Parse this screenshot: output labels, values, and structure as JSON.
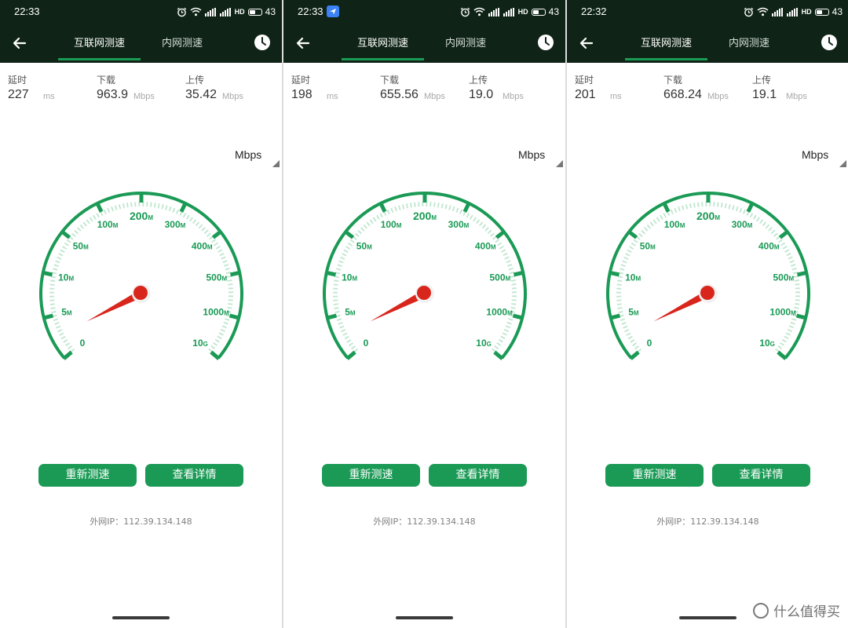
{
  "screens": [
    {
      "status_time": "22:33",
      "has_nav_badge": false,
      "signal_text": "HD",
      "battery": "43",
      "tabs": [
        "互联网测速",
        "内网测速"
      ],
      "metrics": {
        "latency": {
          "label": "延时",
          "value": "227",
          "unit": "ms"
        },
        "download": {
          "label": "下载",
          "value": "963.9",
          "unit": "Mbps"
        },
        "upload": {
          "label": "上传",
          "value": "35.42",
          "unit": "Mbps"
        }
      },
      "unit_selector": "Mbps",
      "gauge_needle_value": "2.5M",
      "buttons": {
        "retest": "重新测速",
        "details": "查看详情"
      },
      "ip_label": "外网IP：",
      "ip_value": "112.39.134.148"
    },
    {
      "status_time": "22:33",
      "has_nav_badge": true,
      "signal_text": "HD",
      "battery": "43",
      "tabs": [
        "互联网测速",
        "内网测速"
      ],
      "metrics": {
        "latency": {
          "label": "延时",
          "value": "198",
          "unit": "ms"
        },
        "download": {
          "label": "下载",
          "value": "655.56",
          "unit": "Mbps"
        },
        "upload": {
          "label": "上传",
          "value": "19.0",
          "unit": "Mbps"
        }
      },
      "unit_selector": "Mbps",
      "gauge_needle_value": "2.5M",
      "buttons": {
        "retest": "重新测速",
        "details": "查看详情"
      },
      "ip_label": "外网IP：",
      "ip_value": "112.39.134.148"
    },
    {
      "status_time": "22:32",
      "has_nav_badge": false,
      "signal_text": "HD",
      "battery": "43",
      "tabs": [
        "互联网测速",
        "内网测速"
      ],
      "metrics": {
        "latency": {
          "label": "延时",
          "value": "201",
          "unit": "ms"
        },
        "download": {
          "label": "下载",
          "value": "668.24",
          "unit": "Mbps"
        },
        "upload": {
          "label": "上传",
          "value": "19.1",
          "unit": "Mbps"
        }
      },
      "unit_selector": "Mbps",
      "gauge_needle_value": "2.5M",
      "buttons": {
        "retest": "重新测速",
        "details": "查看详情"
      },
      "ip_label": "外网IP：",
      "ip_value": "112.39.134.148"
    }
  ],
  "gauge_scale": {
    "ticks": [
      {
        "n": "0",
        "s": ""
      },
      {
        "n": "5",
        "s": "M"
      },
      {
        "n": "10",
        "s": "M"
      },
      {
        "n": "50",
        "s": "M"
      },
      {
        "n": "100",
        "s": "M"
      },
      {
        "n": "200",
        "s": "M"
      },
      {
        "n": "300",
        "s": "M"
      },
      {
        "n": "400",
        "s": "M"
      },
      {
        "n": "500",
        "s": "M"
      },
      {
        "n": "1000",
        "s": "M"
      },
      {
        "n": "10",
        "s": "G"
      }
    ]
  },
  "watermark": "什么值得买",
  "colors": {
    "header_bg": "#0f2417",
    "accent_green": "#1a9a55",
    "needle_red": "#d9261c"
  }
}
